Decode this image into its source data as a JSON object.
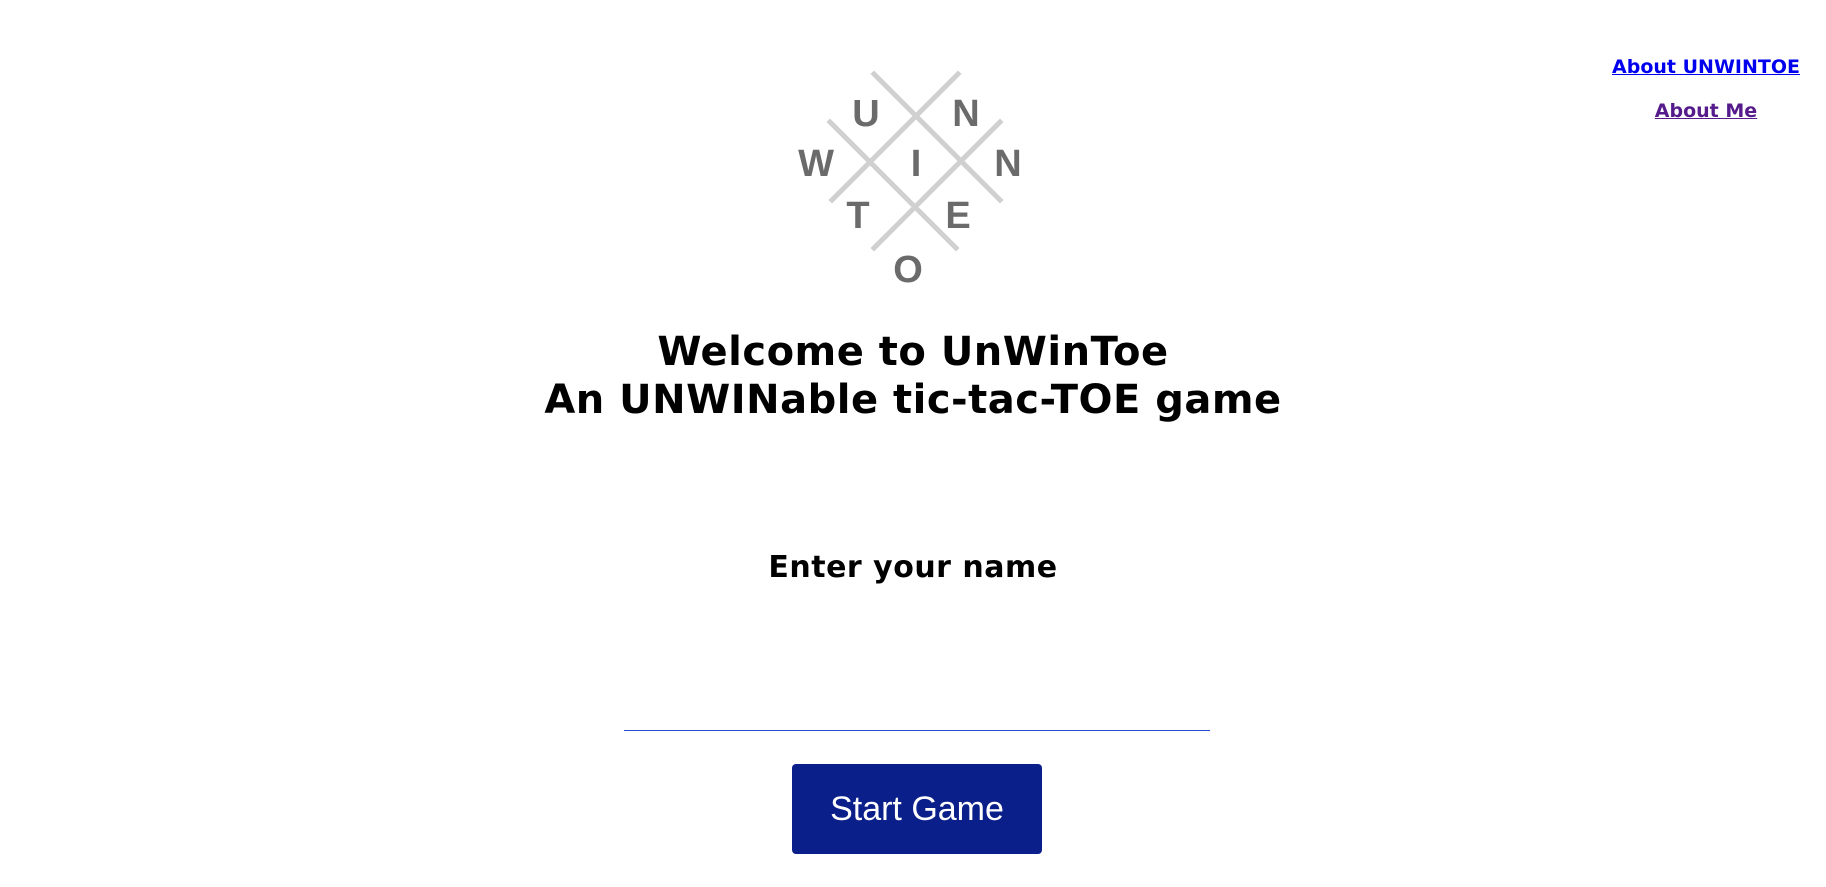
{
  "nav": {
    "about_game": "About UNWINTOE",
    "about_me": "About Me"
  },
  "logo": {
    "letters": [
      "U",
      "N",
      "W",
      "I",
      "N",
      "T",
      "E",
      "O"
    ],
    "line_color": "#d0d0d0",
    "letter_color": "#6b6b6b"
  },
  "heading": {
    "line1": "Welcome to UnWinToe",
    "line2": "An UNWINable tic-tac-TOE game"
  },
  "form": {
    "label": "Enter your name",
    "name_value": "",
    "name_placeholder": "",
    "start_label": "Start Game"
  },
  "colors": {
    "button_bg": "#0b1f8a",
    "input_underline": "#2a4fd6",
    "link": "#0000ee",
    "visited_link": "#551a8b"
  }
}
